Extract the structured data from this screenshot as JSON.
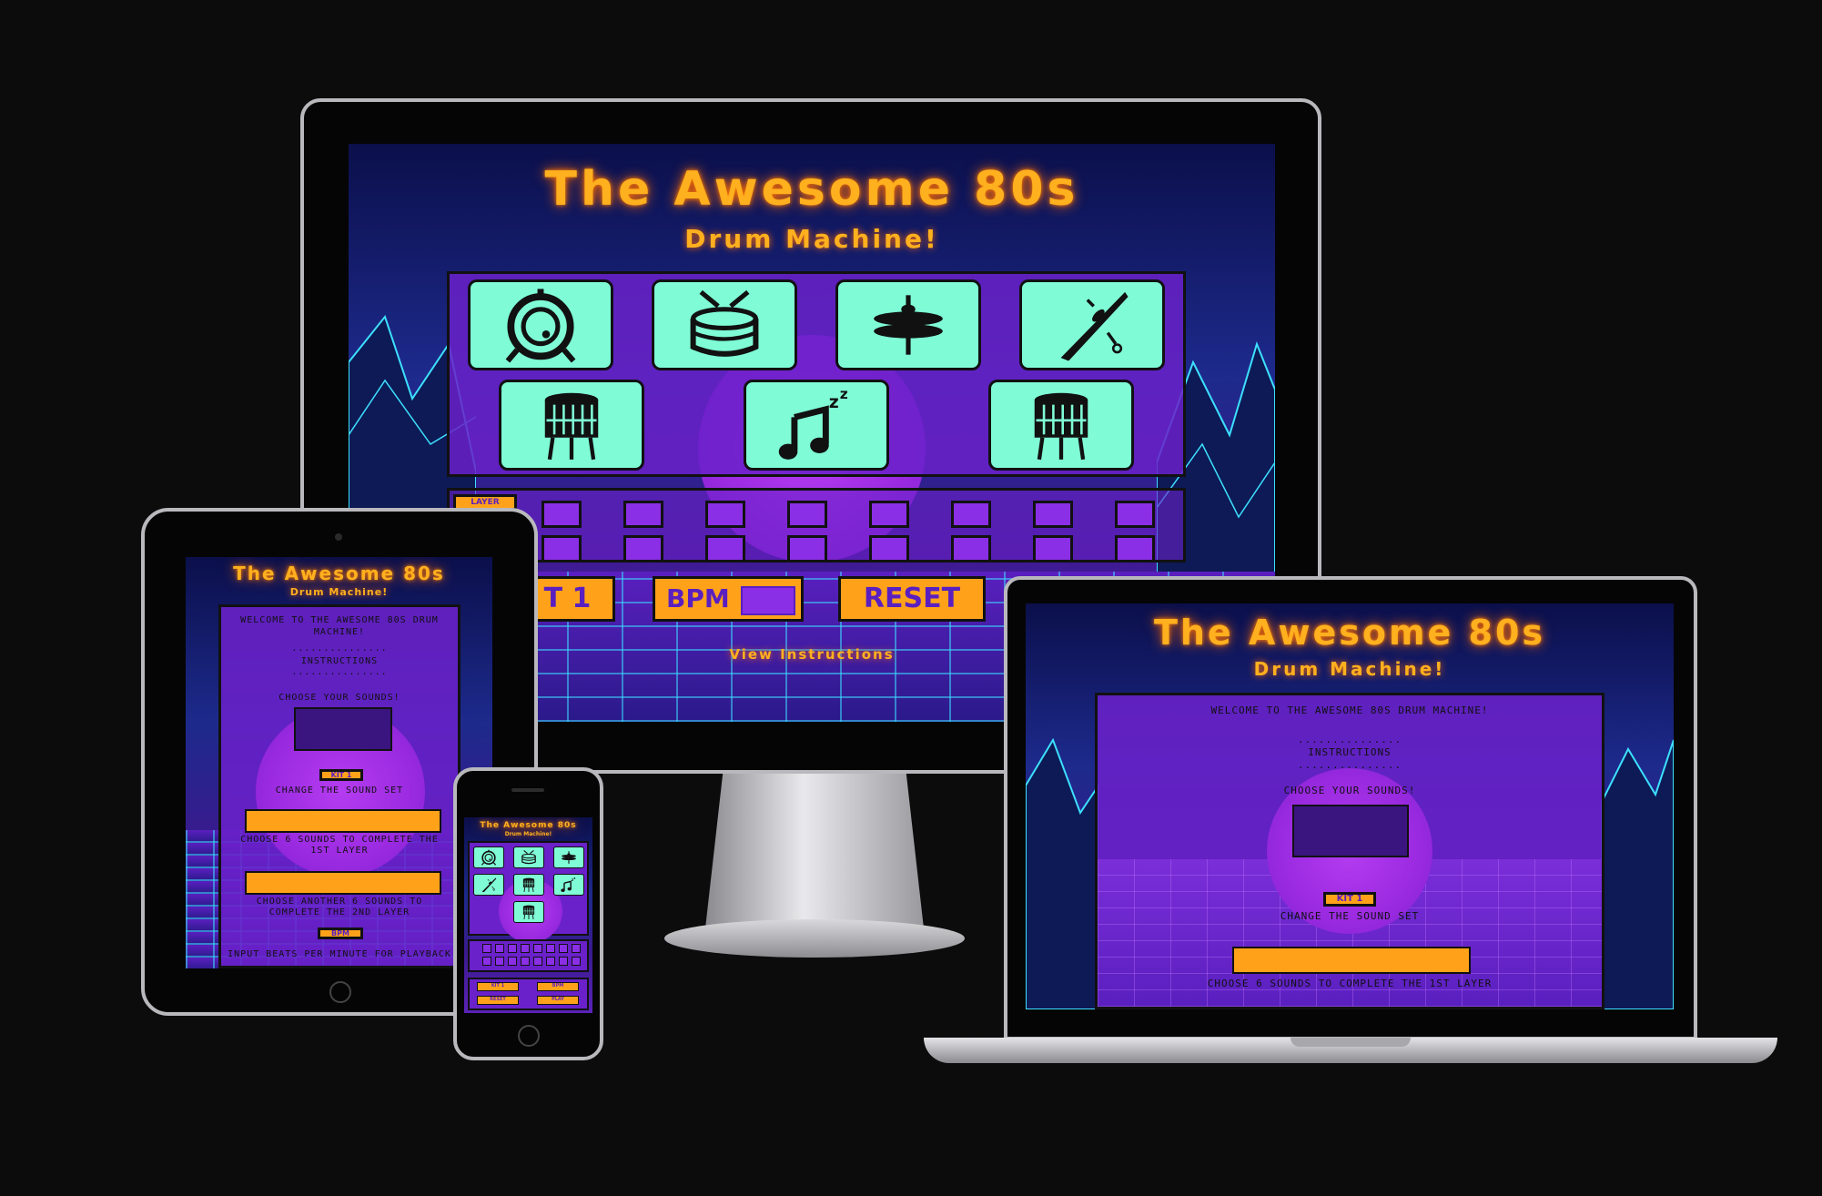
{
  "app": {
    "title": "The Awesome 80s",
    "subtitle": "Drum Machine!"
  },
  "colors": {
    "background": "#0d0c0d",
    "title": "#ffb01e",
    "panel": "#6a21c9",
    "pad": "#7ffcd6",
    "button": "#ffa21a",
    "step": "#8a2fe6"
  },
  "pads": [
    {
      "name": "bass-drum",
      "icon": "bass-drum-icon"
    },
    {
      "name": "snare-drum",
      "icon": "snare-drum-icon"
    },
    {
      "name": "hi-hat",
      "icon": "hi-hat-icon"
    },
    {
      "name": "crash-cymbal",
      "icon": "crash-cymbal-icon"
    },
    {
      "name": "tom-left",
      "icon": "tom-drum-icon"
    },
    {
      "name": "music-sleep",
      "icon": "music-notes-icon"
    },
    {
      "name": "tom-right",
      "icon": "tom-drum-icon"
    }
  ],
  "desktop": {
    "layer_label": "LAYER",
    "kit_button": "T 1",
    "bpm_label": "BPM",
    "reset_button": "RESET",
    "view_instructions": "View Instructions"
  },
  "tablet": {
    "welcome": "WELCOME TO THE AWESOME 80S DRUM MACHINE!",
    "dots": "...............",
    "instructions": "INSTRUCTIONS",
    "choose_sounds": "CHOOSE YOUR SOUNDS!",
    "kit_button": "KIT 1",
    "change_sound_set": "CHANGE THE SOUND SET",
    "layer1_hint": "CHOOSE 6 SOUNDS TO COMPLETE THE 1ST LAYER",
    "layer2_hint": "CHOOSE ANOTHER 6 SOUNDS TO COMPLETE THE 2ND LAYER",
    "bpm_button": "BPM",
    "bpm_hint": "INPUT BEATS PER MINUTE FOR PLAYBACK"
  },
  "laptop": {
    "welcome": "WELCOME TO THE AWESOME 80S DRUM MACHINE!",
    "dots": "...............",
    "instructions": "INSTRUCTIONS",
    "choose_sounds": "CHOOSE YOUR SOUNDS!",
    "kit_button": "KIT 1",
    "change_sound_set": "CHANGE THE SOUND SET",
    "layer1_hint": "CHOOSE 6 SOUNDS TO COMPLETE THE 1ST LAYER"
  },
  "phone": {
    "kit_button": "KIT 1",
    "bpm_button": "BPM",
    "reset_button": "RESET",
    "play_button": "PLAY"
  }
}
